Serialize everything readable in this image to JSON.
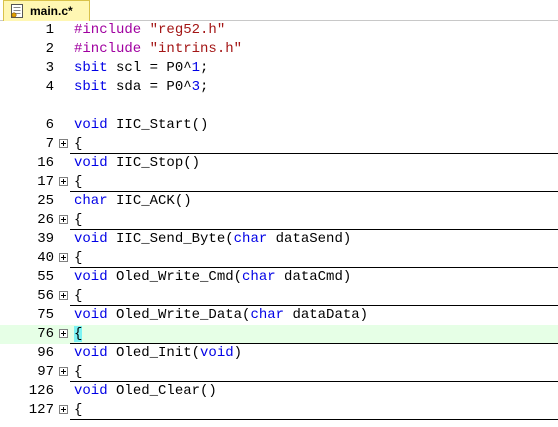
{
  "tab": {
    "label": "main.c*",
    "icon": "c-file-icon"
  },
  "lines": [
    {
      "num": "1",
      "parts": [
        [
          "pp",
          "#include "
        ],
        [
          "str",
          "\"reg52.h\""
        ]
      ]
    },
    {
      "num": "2",
      "parts": [
        [
          "pp",
          "#include "
        ],
        [
          "str",
          "\"intrins.h\""
        ]
      ]
    },
    {
      "num": "3",
      "parts": [
        [
          "kw",
          "sbit"
        ],
        [
          "",
          " scl = P0^"
        ],
        [
          "num",
          "1"
        ],
        [
          "",
          ";"
        ]
      ]
    },
    {
      "num": "4",
      "parts": [
        [
          "kw",
          "sbit"
        ],
        [
          "",
          " sda = P0^"
        ],
        [
          "num",
          "3"
        ],
        [
          "",
          ";"
        ]
      ]
    },
    {
      "num": "",
      "parts": []
    },
    {
      "num": "6",
      "parts": [
        [
          "kw",
          "void"
        ],
        [
          "",
          " IIC_Start()"
        ]
      ]
    },
    {
      "num": "7",
      "parts": [
        [
          "",
          "{"
        ]
      ],
      "fold": true
    },
    {
      "num": "16",
      "parts": [
        [
          "kw",
          "void"
        ],
        [
          "",
          " IIC_Stop()"
        ]
      ]
    },
    {
      "num": "17",
      "parts": [
        [
          "",
          "{"
        ]
      ],
      "fold": true
    },
    {
      "num": "25",
      "parts": [
        [
          "kw",
          "char"
        ],
        [
          "",
          " IIC_ACK()"
        ]
      ]
    },
    {
      "num": "26",
      "parts": [
        [
          "",
          "{"
        ]
      ],
      "fold": true
    },
    {
      "num": "39",
      "parts": [
        [
          "kw",
          "void"
        ],
        [
          "",
          " IIC_Send_Byte("
        ],
        [
          "kw",
          "char"
        ],
        [
          "",
          " dataSend)"
        ]
      ]
    },
    {
      "num": "40",
      "parts": [
        [
          "",
          "{"
        ]
      ],
      "fold": true
    },
    {
      "num": "55",
      "parts": [
        [
          "kw",
          "void"
        ],
        [
          "",
          " Oled_Write_Cmd("
        ],
        [
          "kw",
          "char"
        ],
        [
          "",
          " dataCmd)"
        ]
      ]
    },
    {
      "num": "56",
      "parts": [
        [
          "",
          "{"
        ]
      ],
      "fold": true
    },
    {
      "num": "75",
      "parts": [
        [
          "kw",
          "void"
        ],
        [
          "",
          " Oled_Write_Data("
        ],
        [
          "kw",
          "char"
        ],
        [
          "",
          " dataData)"
        ]
      ]
    },
    {
      "num": "76",
      "parts": [
        [
          "hl",
          "{"
        ]
      ],
      "fold": true,
      "current": true
    },
    {
      "num": "96",
      "parts": [
        [
          "kw",
          "void"
        ],
        [
          "",
          " Oled_Init("
        ],
        [
          "kw",
          "void"
        ],
        [
          "",
          ")"
        ]
      ]
    },
    {
      "num": "97",
      "parts": [
        [
          "",
          "{"
        ]
      ],
      "fold": true
    },
    {
      "num": "126",
      "parts": [
        [
          "kw",
          "void"
        ],
        [
          "",
          " Oled_Clear()"
        ]
      ]
    },
    {
      "num": "127",
      "parts": [
        [
          "",
          "{"
        ]
      ],
      "fold": true
    }
  ]
}
